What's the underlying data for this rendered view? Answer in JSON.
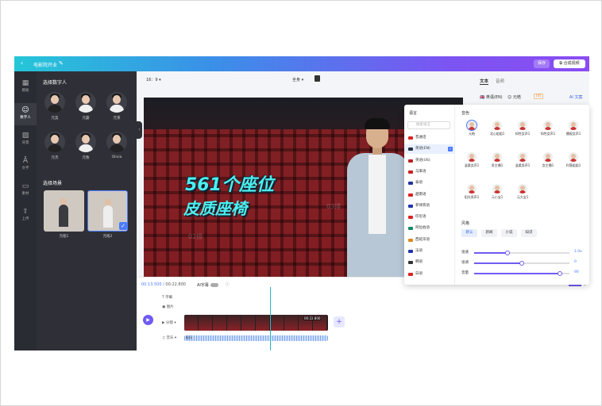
{
  "title": {
    "project": "电影院开业",
    "save": "保存",
    "export": "合成视频"
  },
  "nav": [
    {
      "label": "模板",
      "icon": "grid-icon"
    },
    {
      "label": "数字人",
      "icon": "person-icon"
    },
    {
      "label": "背景",
      "icon": "pattern-icon"
    },
    {
      "label": "文字",
      "icon": "text-icon"
    },
    {
      "label": "素材",
      "icon": "folder-icon"
    },
    {
      "label": "上传",
      "icon": "upload-icon"
    }
  ],
  "panel": {
    "heading": "选择数字人",
    "avatars": [
      {
        "name": "元昊"
      },
      {
        "name": "元霸"
      },
      {
        "name": "元莱"
      },
      {
        "name": "元杰"
      },
      {
        "name": "元致"
      },
      {
        "name": "Olivia"
      }
    ],
    "scene_heading": "选择场景",
    "scenes": [
      {
        "name": "元皓1"
      },
      {
        "name": "元皓2"
      }
    ]
  },
  "toolbar": {
    "ratio": "16：9",
    "fullscreen": "全身"
  },
  "canvas": {
    "caption1": "561个座位",
    "caption2": "皮质座椅",
    "watermark1": "03排",
    "watermark2": "02排"
  },
  "right": {
    "tabs": [
      "文本",
      "音频"
    ],
    "lang": "英语(EN)",
    "voice": "元皓",
    "badge": "[0]",
    "ai": "AI 文案"
  },
  "dropdown": {
    "lang_title": "语言",
    "search_placeholder": "搜索语言",
    "languages": [
      {
        "name": "普通话",
        "color": "#d22"
      },
      {
        "name": "英语(EN)",
        "color": "#234",
        "active": true
      },
      {
        "name": "英语(US)",
        "color": "#b22"
      },
      {
        "name": "马来语",
        "color": "#c22"
      },
      {
        "name": "泰语",
        "color": "#239"
      },
      {
        "name": "越南语",
        "color": "#d22"
      },
      {
        "name": "菲律宾语",
        "color": "#23a"
      },
      {
        "name": "印尼语",
        "color": "#d22"
      },
      {
        "name": "阿拉伯语",
        "color": "#186"
      },
      {
        "name": "西班牙语",
        "color": "#d82"
      },
      {
        "name": "法语",
        "color": "#23a"
      },
      {
        "name": "韩语",
        "color": "#333"
      },
      {
        "name": "日语",
        "color": "#d22"
      }
    ],
    "voice_title": "音色",
    "voices": [
      {
        "name": "元皓",
        "selected": true
      },
      {
        "name": "北心姐姐1"
      },
      {
        "name": "知性女声1"
      },
      {
        "name": "知性女声1"
      },
      {
        "name": "播报女声1"
      },
      {
        "name": "温柔女声1"
      },
      {
        "name": "男主播1"
      },
      {
        "name": "温柔男声1"
      },
      {
        "name": "女主播1"
      },
      {
        "name": "利落姐姐1"
      },
      {
        "name": "阳光男声1"
      },
      {
        "name": "元小宝1"
      },
      {
        "name": "元大宝1"
      }
    ],
    "style_title": "风格",
    "styles": [
      {
        "label": "默认",
        "active": true
      },
      {
        "label": "新闻"
      },
      {
        "label": "小说"
      },
      {
        "label": "知识"
      }
    ],
    "sliders": [
      {
        "label": "语速",
        "value": "1.0x",
        "fraction": 0.35
      },
      {
        "label": "语调",
        "value": "0",
        "fraction": 0.5
      },
      {
        "label": "音量",
        "value": "90",
        "fraction": 0.9
      }
    ]
  },
  "timeline": {
    "current": "00:13.500",
    "total": "00:22.800",
    "ai_caption": "AI字幕",
    "tracks": [
      "字幕",
      "图片",
      "分镜",
      "音乐"
    ],
    "clip_time": "00:22.800",
    "audio_name": "配乐"
  }
}
